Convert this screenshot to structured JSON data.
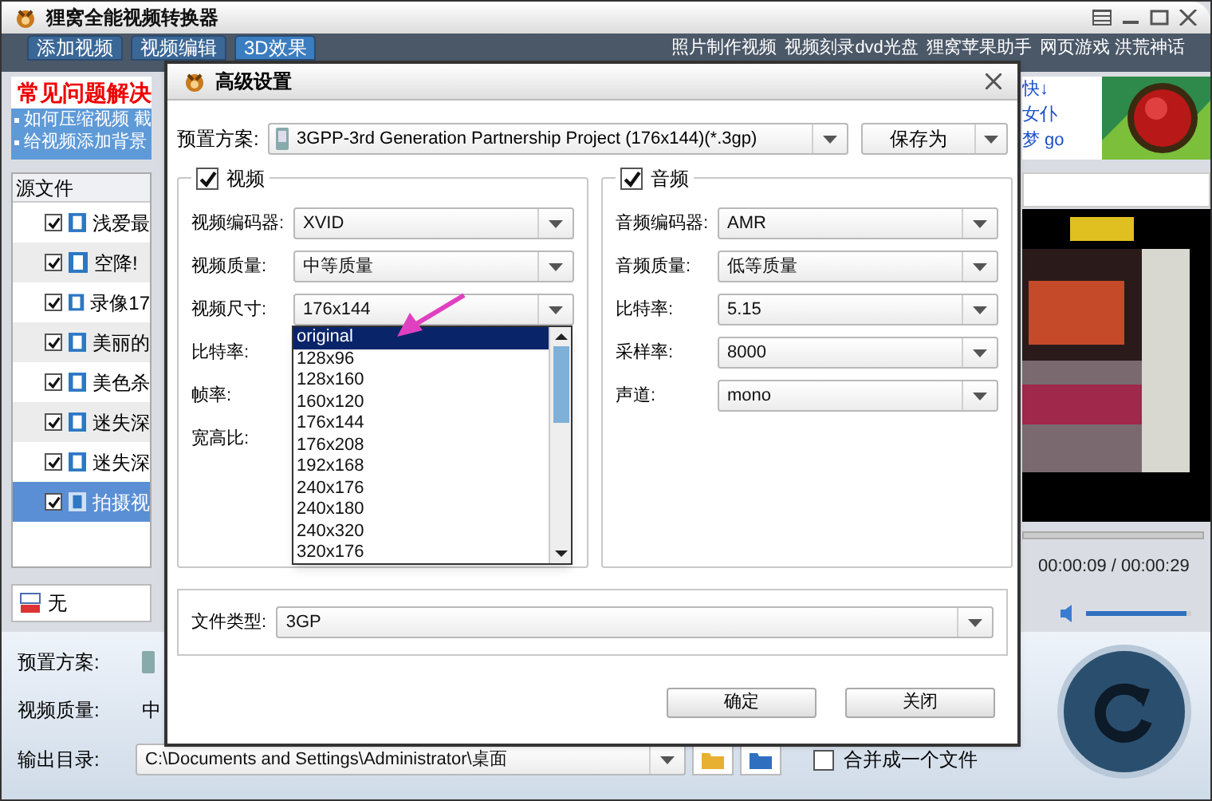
{
  "window": {
    "title": "狸窝全能视频转换器"
  },
  "toolbar": {
    "buttons": [
      {
        "label": "添加视频",
        "selected": false
      },
      {
        "label": "视频编辑",
        "selected": false
      },
      {
        "label": "3D效果",
        "selected": true
      }
    ],
    "links": [
      "照片制作视频",
      "视频刻录dvd光盘",
      "狸窝苹果助手",
      "网页游戏 洪荒神话"
    ]
  },
  "faq": {
    "heading": "常见问题解决",
    "items": [
      "如何压缩视频 截",
      "给视频添加背景"
    ]
  },
  "ad": {
    "lines": [
      "快↓",
      "女仆",
      "梦 go"
    ]
  },
  "file_list": {
    "header": "源文件",
    "items": [
      {
        "name": "浅爱最",
        "checked": true,
        "selected": false
      },
      {
        "name": "空降!",
        "checked": true,
        "selected": false
      },
      {
        "name": "录像17",
        "checked": true,
        "selected": false
      },
      {
        "name": "美丽的",
        "checked": true,
        "selected": false
      },
      {
        "name": "美色杀",
        "checked": true,
        "selected": false
      },
      {
        "name": "迷失深",
        "checked": true,
        "selected": false
      },
      {
        "name": "迷失深",
        "checked": true,
        "selected": false
      },
      {
        "name": "拍摄视",
        "checked": true,
        "selected": true
      }
    ]
  },
  "subtitle": {
    "value": "无"
  },
  "player": {
    "time": "00:00:09 / 00:00:29",
    "volume": {
      "level": 0.95
    }
  },
  "bottom": {
    "preset_label": "预置方案:",
    "quality_label": "视频质量:",
    "quality_value": "中",
    "output_label": "输出目录:",
    "output_path": "C:\\Documents and Settings\\Administrator\\桌面",
    "merge": {
      "label": "合并成一个文件",
      "checked": false
    }
  },
  "dialog": {
    "title": "高级设置",
    "preset_label": "预置方案:",
    "preset_value": "3GPP-3rd Generation Partnership Project (176x144)(*.3gp)",
    "save_button": "保存为",
    "video": {
      "label": "视频",
      "checked": true,
      "fields": [
        {
          "label": "视频编码器:",
          "value": "XVID"
        },
        {
          "label": "视频质量:",
          "value": "中等质量"
        },
        {
          "label": "视频尺寸:",
          "value": "176x144"
        },
        {
          "label": "比特率:"
        },
        {
          "label": "帧率:"
        },
        {
          "label": "宽高比:"
        }
      ]
    },
    "size_options": [
      {
        "label": "original",
        "selected": true
      },
      {
        "label": "128x96",
        "selected": false
      },
      {
        "label": "128x160",
        "selected": false
      },
      {
        "label": "160x120",
        "selected": false
      },
      {
        "label": "176x144",
        "selected": false
      },
      {
        "label": "176x208",
        "selected": false
      },
      {
        "label": "192x168",
        "selected": false
      },
      {
        "label": "240x176",
        "selected": false
      },
      {
        "label": "240x180",
        "selected": false
      },
      {
        "label": "240x320",
        "selected": false
      },
      {
        "label": "320x176",
        "selected": false
      }
    ],
    "audio": {
      "label": "音频",
      "checked": true,
      "fields": [
        {
          "label": "音频编码器:",
          "value": "AMR"
        },
        {
          "label": "音频质量:",
          "value": "低等质量"
        },
        {
          "label": "比特率:",
          "value": "5.15"
        },
        {
          "label": "采样率:",
          "value": "8000"
        },
        {
          "label": "声道:",
          "value": "mono"
        }
      ]
    },
    "file_type": {
      "label": "文件类型:",
      "value": "3GP"
    },
    "buttons": [
      "确定",
      "关闭"
    ]
  }
}
